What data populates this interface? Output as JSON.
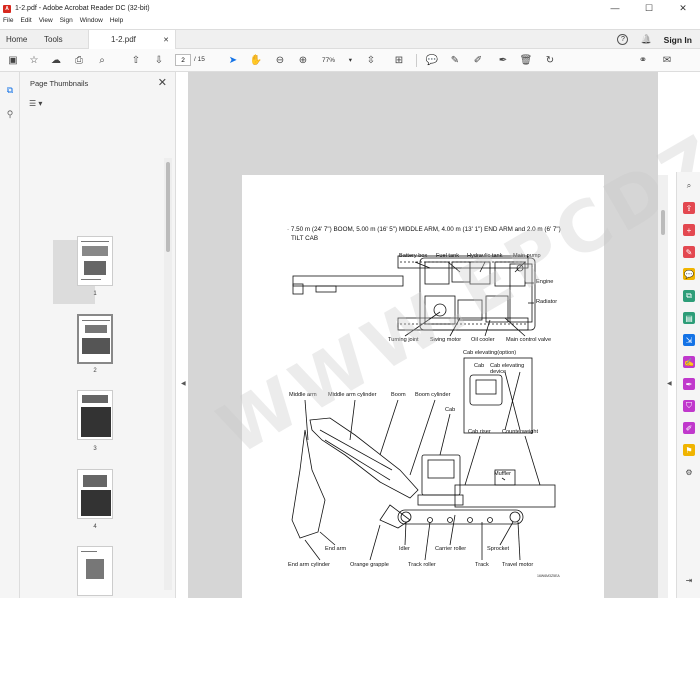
{
  "window": {
    "title": "1-2.pdf - Adobe Acrobat Reader DC (32-bit)",
    "minimize": "—",
    "maximize": "☐",
    "close": "✕"
  },
  "menu": [
    "File",
    "Edit",
    "View",
    "Sign",
    "Window",
    "Help"
  ],
  "tabs": {
    "home": "Home",
    "tools": "Tools",
    "doc": "1-2.pdf",
    "doc_close": "✕",
    "help": "?",
    "bell": "🔔",
    "signin": "Sign In"
  },
  "toolbar": {
    "page_current": "2",
    "page_total": "/ 15",
    "zoom": "77%",
    "zoom_arrow": "▾"
  },
  "thumbnails": {
    "title": "Page Thumbnails",
    "close": "✕",
    "options": "☰ ▾",
    "pages": [
      "1",
      "2",
      "3",
      "4"
    ]
  },
  "document": {
    "heading_line1": "· 7.50 m (24' 7\") BOOM, 5.00 m (16' 5\") MIDDLE ARM, 4.00 m (13' 1\") END ARM and 2.0 m (6' 7\")",
    "heading_line2": "TILT CAB",
    "labels": {
      "battery_box": "Battery box",
      "fuel_tank": "Fuel tank",
      "hydraulic_tank": "Hydraulic tank",
      "main_pump": "Main pump",
      "engine": "Engine",
      "radiator": "Radiator",
      "turning_joint": "Turning joint",
      "swing_motor": "Swing motor",
      "oil_cooler": "Oil cooler",
      "main_control_valve": "Main control valve",
      "cab_elevating_option": "Cab elevating(option)",
      "cab_top": "Cab",
      "cab_elevating_device": "Cab elevating device",
      "middle_arm": "Middle arm",
      "middle_arm_cylinder": "Middle arm cylinder",
      "boom": "Boom",
      "boom_cylinder": "Boom cylinder",
      "cab": "Cab",
      "cab_riser": "Cab riser",
      "counterweight": "Counterweight",
      "muffler": "Muffler",
      "end_arm": "End arm",
      "end_arm_cylinder": "End arm cylinder",
      "orange_grapple": "Orange grapple",
      "idler": "Idler",
      "carrier_roller": "Carrier roller",
      "sprocket": "Sprocket",
      "track_roller": "Track roller",
      "track": "Track",
      "travel_motor": "Travel motor"
    },
    "figure_code": "16W6M3Z5EA",
    "watermark": "WWW.EPCDZG.COM"
  },
  "colors": {
    "accent": "#1473e6",
    "pdf_red": "#d7281e"
  }
}
